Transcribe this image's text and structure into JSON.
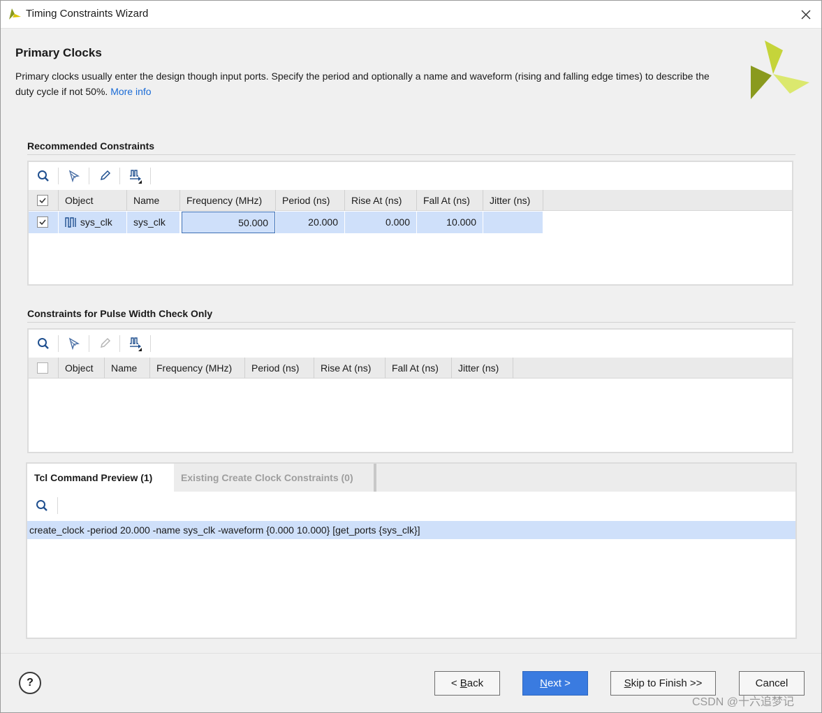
{
  "window": {
    "title": "Timing Constraints Wizard"
  },
  "header": {
    "heading": "Primary Clocks",
    "description": "Primary clocks usually enter the design though input ports. Specify the period and optionally a name and waveform (rising and falling edge times) to describe the duty cycle if not 50%.",
    "more_info": "More info"
  },
  "recommended": {
    "title": "Recommended Constraints",
    "columns": [
      "Object",
      "Name",
      "Frequency (MHz)",
      "Period (ns)",
      "Rise At (ns)",
      "Fall At (ns)",
      "Jitter (ns)"
    ],
    "rows": [
      {
        "checked": true,
        "object": "sys_clk",
        "name": "sys_clk",
        "frequency": "50.000",
        "period": "20.000",
        "rise": "0.000",
        "fall": "10.000",
        "jitter": ""
      }
    ]
  },
  "pulse": {
    "title": "Constraints for Pulse Width Check Only",
    "columns": [
      "Object",
      "Name",
      "Frequency (MHz)",
      "Period (ns)",
      "Rise At (ns)",
      "Fall At (ns)",
      "Jitter (ns)"
    ]
  },
  "tabs": [
    {
      "label": "Tcl Command Preview (1)"
    },
    {
      "label": "Existing Create Clock Constraints (0)"
    }
  ],
  "tcl": {
    "line": "create_clock -period 20.000 -name sys_clk -waveform {0.000 10.000} [get_ports {sys_clk}]"
  },
  "footer": {
    "help": "?",
    "back": {
      "pre": "< ",
      "key": "B",
      "rest": "ack"
    },
    "next": {
      "key": "N",
      "rest": "ext >"
    },
    "skip": {
      "key": "S",
      "rest": "kip to Finish >>"
    },
    "cancel": "Cancel"
  },
  "watermark": "CSDN @十六追梦记",
  "colors": {
    "accent": "#3a7be0",
    "selection": "#cfe0fa",
    "link": "#1a6bd6",
    "logo_dark": "#8a9a1e",
    "logo_light": "#d9e870"
  }
}
